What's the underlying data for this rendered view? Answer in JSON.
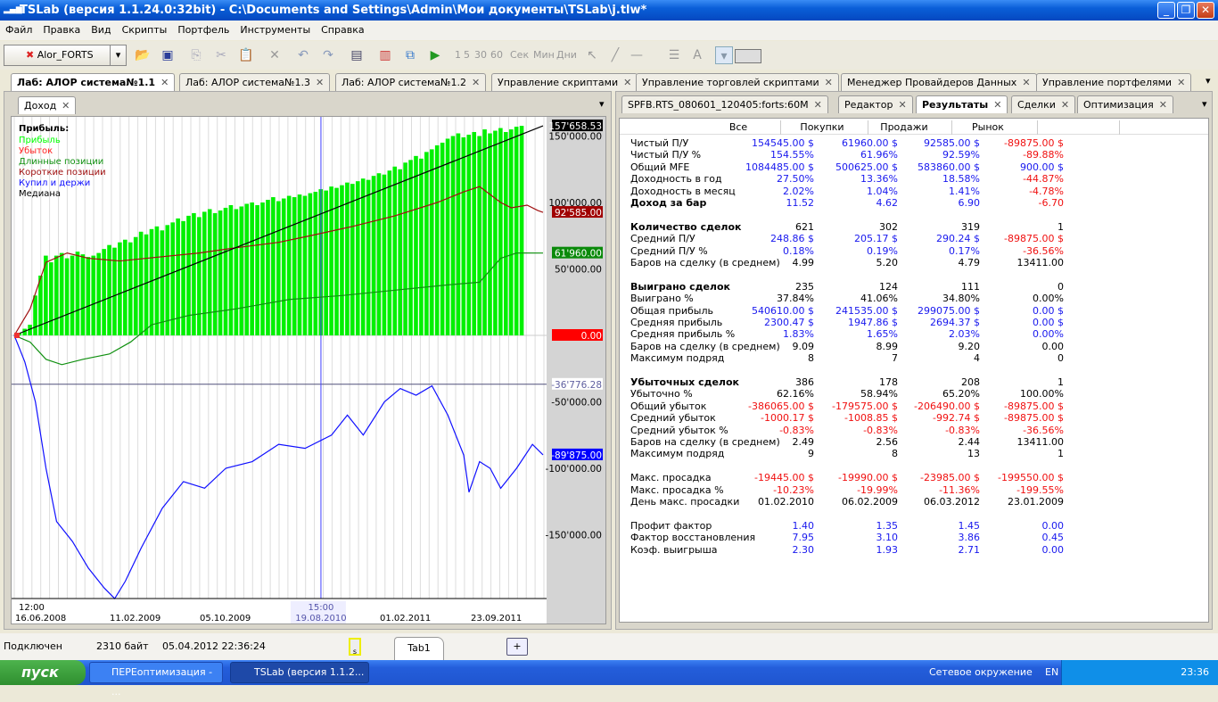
{
  "window": {
    "title": "TSLab (версия 1.1.24.0:32bit) - C:\\Documents and Settings\\Admin\\Мои документы\\TSLab\\j.tlw*"
  },
  "menu": [
    "Файл",
    "Правка",
    "Вид",
    "Скрипты",
    "Портфель",
    "Инструменты",
    "Справка"
  ],
  "toolbar": {
    "provider": "Alor_FORTS",
    "intervals": [
      "1",
      "5",
      "30",
      "60"
    ],
    "units": [
      "Сек",
      "Мин",
      "Дни"
    ]
  },
  "main_tabs": [
    "Лаб: АЛОР система№1.1",
    "Лаб: АЛОР система№1.3",
    "Лаб: АЛОР система№1.2",
    "Управление скриптами",
    "Управление торговлей скриптами",
    "Менеджер Провайдеров Данных",
    "Управление портфелями"
  ],
  "left_tab": "Доход",
  "right_tabs": [
    "SPFB.RTS_080601_120405:forts:60M",
    "Редактор",
    "Результаты",
    "Сделки",
    "Оптимизация"
  ],
  "chart_data": {
    "type": "bar+line",
    "title": "Прибыль:",
    "legend": [
      {
        "name": "Прибыль",
        "color": "#00ff00"
      },
      {
        "name": "Убыток",
        "color": "#ff2020"
      },
      {
        "name": "Длинные позиции",
        "color": "#109010"
      },
      {
        "name": "Короткие позиции",
        "color": "#a01010"
      },
      {
        "name": "Купил и держи",
        "color": "#1010ff"
      },
      {
        "name": "Медиана",
        "color": "#000000"
      }
    ],
    "ylim": [
      -200000,
      160000
    ],
    "yticks": [
      "150'000.00",
      "100'000.00",
      "50'000.00",
      "-50'000.00",
      "-100'000.00",
      "-150'000.00"
    ],
    "ytick_values": [
      150000,
      100000,
      50000,
      -50000,
      -100000,
      -150000
    ],
    "markers": [
      {
        "label": "157'658.53",
        "value": 157658.53,
        "bg": "#000000",
        "fg": "#ffffff"
      },
      {
        "label": "92'585.00",
        "value": 92585,
        "bg": "#a00000",
        "fg": "#ffffff"
      },
      {
        "label": "61'960.00",
        "value": 61960,
        "bg": "#0a8a0a",
        "fg": "#ffffff"
      },
      {
        "label": "0.00",
        "value": 0,
        "bg": "#ff0000",
        "fg": "#ffffff"
      },
      {
        "label": "-36'776.28",
        "value": -36776.28,
        "bg": "#ffffff",
        "fg": "#6060a0"
      },
      {
        "label": "-89'875.00",
        "value": -89875,
        "bg": "#0000ff",
        "fg": "#ffffff"
      }
    ],
    "xticks": [
      "16.06.2008",
      "11.02.2009",
      "05.10.2009",
      "19.08.2010",
      "01.02.2011",
      "23.09.2011"
    ],
    "xtick_top": "12:00",
    "cursor": {
      "time": "15:00",
      "date": "19.08.2010",
      "index": 58
    },
    "hline": -36776.28,
    "bars_profit": [
      2000,
      5000,
      8000,
      30000,
      45000,
      60000,
      55000,
      60000,
      62000,
      58000,
      60000,
      63000,
      61000,
      59000,
      60000,
      62000,
      65000,
      68000,
      66000,
      70000,
      72000,
      70000,
      74000,
      78000,
      76000,
      80000,
      82000,
      79000,
      83000,
      85000,
      88000,
      86000,
      90000,
      92000,
      89000,
      93000,
      95000,
      92000,
      94000,
      96000,
      98000,
      95000,
      97000,
      99000,
      100000,
      98000,
      100000,
      102000,
      104000,
      101000,
      103000,
      105000,
      104000,
      106000,
      105000,
      107000,
      108000,
      110000,
      109000,
      112000,
      111000,
      113000,
      115000,
      114000,
      116000,
      118000,
      117000,
      120000,
      122000,
      121000,
      124000,
      127000,
      125000,
      130000,
      132000,
      135000,
      133000,
      138000,
      140000,
      143000,
      145000,
      148000,
      150000,
      152000,
      149000,
      151000,
      153000,
      150000,
      155000,
      152000,
      154000,
      156000,
      153000,
      155000,
      157000,
      157658
    ],
    "short": [
      [
        0,
        0
      ],
      [
        3,
        20000
      ],
      [
        6,
        55000
      ],
      [
        10,
        62000
      ],
      [
        14,
        58000
      ],
      [
        20,
        56000
      ],
      [
        25,
        58000
      ],
      [
        35,
        62000
      ],
      [
        42,
        66000
      ],
      [
        50,
        70000
      ],
      [
        56,
        75000
      ],
      [
        64,
        82000
      ],
      [
        72,
        90000
      ],
      [
        80,
        100000
      ],
      [
        85,
        108000
      ],
      [
        88,
        112000
      ],
      [
        92,
        100000
      ],
      [
        94,
        96000
      ],
      [
        97,
        98000
      ],
      [
        99,
        94000
      ],
      [
        100,
        92585
      ]
    ],
    "long": [
      [
        0,
        0
      ],
      [
        3,
        -5000
      ],
      [
        6,
        -18000
      ],
      [
        9,
        -22000
      ],
      [
        13,
        -18000
      ],
      [
        18,
        -14000
      ],
      [
        22,
        -5000
      ],
      [
        26,
        8000
      ],
      [
        33,
        15000
      ],
      [
        42,
        20000
      ],
      [
        52,
        27000
      ],
      [
        62,
        30000
      ],
      [
        72,
        34000
      ],
      [
        82,
        38000
      ],
      [
        88,
        40000
      ],
      [
        92,
        58000
      ],
      [
        95,
        62000
      ],
      [
        100,
        61960
      ]
    ],
    "buy_hold": [
      [
        0,
        0
      ],
      [
        2,
        -20000
      ],
      [
        4,
        -50000
      ],
      [
        6,
        -100000
      ],
      [
        8,
        -140000
      ],
      [
        11,
        -155000
      ],
      [
        14,
        -175000
      ],
      [
        17,
        -190000
      ],
      [
        19,
        -198000
      ],
      [
        21,
        -185000
      ],
      [
        24,
        -160000
      ],
      [
        28,
        -130000
      ],
      [
        32,
        -110000
      ],
      [
        36,
        -115000
      ],
      [
        40,
        -100000
      ],
      [
        45,
        -95000
      ],
      [
        50,
        -82000
      ],
      [
        55,
        -85000
      ],
      [
        60,
        -75000
      ],
      [
        63,
        -60000
      ],
      [
        66,
        -75000
      ],
      [
        70,
        -50000
      ],
      [
        73,
        -40000
      ],
      [
        76,
        -45000
      ],
      [
        79,
        -38000
      ],
      [
        82,
        -60000
      ],
      [
        85,
        -90000
      ],
      [
        86,
        -118000
      ],
      [
        88,
        -95000
      ],
      [
        90,
        -100000
      ],
      [
        92,
        -115000
      ],
      [
        95,
        -100000
      ],
      [
        98,
        -82000
      ],
      [
        100,
        -89875
      ]
    ],
    "median": [
      [
        0,
        0
      ],
      [
        100,
        157658.53
      ]
    ]
  },
  "results": {
    "headers": [
      "Все",
      "Покупки",
      "Продажи",
      "Рынок"
    ],
    "rows": [
      {
        "label": "Чистый П/У",
        "values": [
          "154545.00 $",
          "61960.00 $",
          "92585.00 $",
          "-89875.00 $"
        ],
        "colors": "bbbr"
      },
      {
        "label": "Чистый П/У %",
        "values": [
          "154.55%",
          "61.96%",
          "92.59%",
          "-89.88%"
        ],
        "colors": "bbbr"
      },
      {
        "label": "Общий MFE",
        "values": [
          "1084485.00 $",
          "500625.00 $",
          "583860.00 $",
          "900.00 $"
        ],
        "colors": "bbbb"
      },
      {
        "label": "Доходность в год",
        "values": [
          "27.50%",
          "13.36%",
          "18.58%",
          "-44.87%"
        ],
        "colors": "bbbr"
      },
      {
        "label": "Доходность в месяц",
        "values": [
          "2.02%",
          "1.04%",
          "1.41%",
          "-4.78%"
        ],
        "colors": "bbbr"
      },
      {
        "label": "Доход за бар",
        "bold": true,
        "values": [
          "11.52",
          "4.62",
          "6.90",
          "-6.70"
        ],
        "colors": "bbbr"
      },
      {
        "label": "",
        "values": [
          "",
          "",
          "",
          ""
        ],
        "colors": "kkkk"
      },
      {
        "label": "Количество сделок",
        "bold": true,
        "values": [
          "621",
          "302",
          "319",
          "1"
        ],
        "colors": "kkkk"
      },
      {
        "label": "Средний П/У",
        "values": [
          "248.86 $",
          "205.17 $",
          "290.24 $",
          "-89875.00 $"
        ],
        "colors": "bbbr"
      },
      {
        "label": "Средний П/У %",
        "values": [
          "0.18%",
          "0.19%",
          "0.17%",
          "-36.56%"
        ],
        "colors": "bbbr"
      },
      {
        "label": "Баров на сделку (в среднем)",
        "values": [
          "4.99",
          "5.20",
          "4.79",
          "13411.00"
        ],
        "colors": "kkkk"
      },
      {
        "label": "",
        "values": [
          "",
          "",
          "",
          ""
        ],
        "colors": "kkkk"
      },
      {
        "label": "Выиграно сделок",
        "bold": true,
        "values": [
          "235",
          "124",
          "111",
          "0"
        ],
        "colors": "kkkk"
      },
      {
        "label": "Выиграно %",
        "values": [
          "37.84%",
          "41.06%",
          "34.80%",
          "0.00%"
        ],
        "colors": "kkkk"
      },
      {
        "label": "Общая прибыль",
        "values": [
          "540610.00 $",
          "241535.00 $",
          "299075.00 $",
          "0.00 $"
        ],
        "colors": "bbbb"
      },
      {
        "label": "Средняя прибыль",
        "values": [
          "2300.47 $",
          "1947.86 $",
          "2694.37 $",
          "0.00 $"
        ],
        "colors": "bbbb"
      },
      {
        "label": "Средняя прибыль %",
        "values": [
          "1.83%",
          "1.65%",
          "2.03%",
          "0.00%"
        ],
        "colors": "bbbb"
      },
      {
        "label": "Баров на сделку (в среднем)",
        "values": [
          "9.09",
          "8.99",
          "9.20",
          "0.00"
        ],
        "colors": "kkkk"
      },
      {
        "label": "Максимум подряд",
        "values": [
          "8",
          "7",
          "4",
          "0"
        ],
        "colors": "kkkk"
      },
      {
        "label": "",
        "values": [
          "",
          "",
          "",
          ""
        ],
        "colors": "kkkk"
      },
      {
        "label": "Убыточных сделок",
        "bold": true,
        "values": [
          "386",
          "178",
          "208",
          "1"
        ],
        "colors": "kkkk"
      },
      {
        "label": "Убыточно %",
        "values": [
          "62.16%",
          "58.94%",
          "65.20%",
          "100.00%"
        ],
        "colors": "kkkk"
      },
      {
        "label": "Общий убыток",
        "values": [
          "-386065.00 $",
          "-179575.00 $",
          "-206490.00 $",
          "-89875.00 $"
        ],
        "colors": "rrrr"
      },
      {
        "label": "Средний убыток",
        "values": [
          "-1000.17 $",
          "-1008.85 $",
          "-992.74 $",
          "-89875.00 $"
        ],
        "colors": "rrrr"
      },
      {
        "label": "Средний убыток %",
        "values": [
          "-0.83%",
          "-0.83%",
          "-0.83%",
          "-36.56%"
        ],
        "colors": "rrrr"
      },
      {
        "label": "Баров на сделку (в среднем)",
        "values": [
          "2.49",
          "2.56",
          "2.44",
          "13411.00"
        ],
        "colors": "kkkk"
      },
      {
        "label": "Максимум подряд",
        "values": [
          "9",
          "8",
          "13",
          "1"
        ],
        "colors": "kkkk"
      },
      {
        "label": "",
        "values": [
          "",
          "",
          "",
          ""
        ],
        "colors": "kkkk"
      },
      {
        "label": "Макс. просадка",
        "values": [
          "-19445.00 $",
          "-19990.00 $",
          "-23985.00 $",
          "-199550.00 $"
        ],
        "colors": "rrrr"
      },
      {
        "label": "Макс. просадка %",
        "values": [
          "-10.23%",
          "-19.99%",
          "-11.36%",
          "-199.55%"
        ],
        "colors": "rrrr"
      },
      {
        "label": "День макс. просадки",
        "values": [
          "01.02.2010",
          "06.02.2009",
          "06.03.2012",
          "23.01.2009"
        ],
        "colors": "kkkk"
      },
      {
        "label": "",
        "values": [
          "",
          "",
          "",
          ""
        ],
        "colors": "kkkk"
      },
      {
        "label": "Профит фактор",
        "values": [
          "1.40",
          "1.35",
          "1.45",
          "0.00"
        ],
        "colors": "bbbb"
      },
      {
        "label": "Фактор восстановления",
        "values": [
          "7.95",
          "3.10",
          "3.86",
          "0.45"
        ],
        "colors": "bbbb"
      },
      {
        "label": "Коэф. выигрыша",
        "values": [
          "2.30",
          "1.93",
          "2.71",
          "0.00"
        ],
        "colors": "bbbb"
      }
    ]
  },
  "status": {
    "connection": "Подключен",
    "bytes": "2310 байт",
    "datetime": "05.04.2012 22:36:24",
    "tab": "Tab1",
    "add": "+",
    "script_icon": "s"
  },
  "taskbar": {
    "start": "пуск",
    "items": [
      "ПЕРЕоптимизация - ...",
      "TSLab (версия 1.1.2..."
    ],
    "network": "Сетевое окружение",
    "lang": "EN",
    "clock": "23:36"
  }
}
